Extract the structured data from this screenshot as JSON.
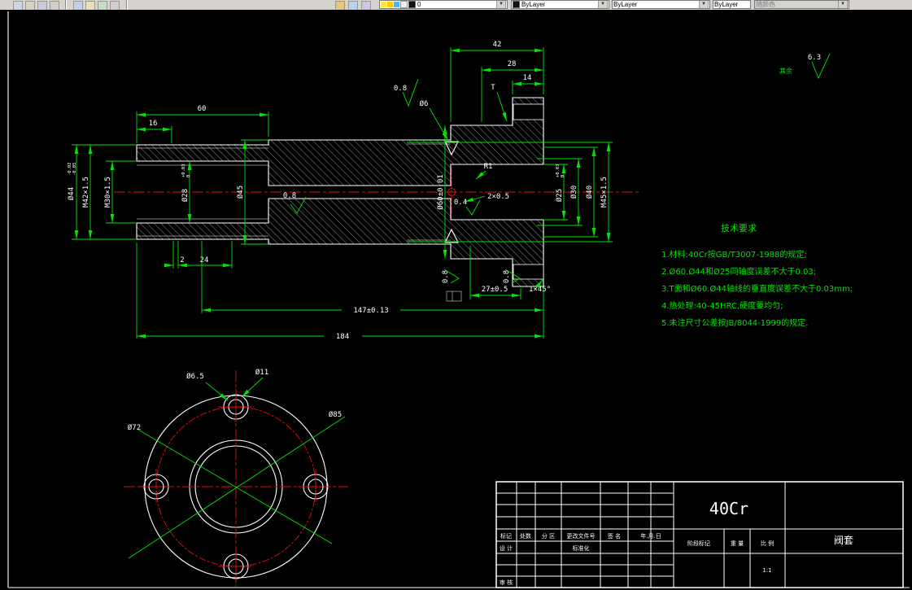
{
  "toolbar": {
    "layer_value": "0",
    "color_value": "ByLayer",
    "linetype_value": "ByLayer",
    "lineweight_value": "ByLayer",
    "plotstyle_value": "随颜色"
  },
  "section_view": {
    "dims": {
      "len184": "184",
      "len147": "147±0.13",
      "len60": "60",
      "len16": "16",
      "len42": "42",
      "len28": "28",
      "len14": "14",
      "len2": "2",
      "len24": "24",
      "len27": "27±0.5",
      "chamfer": "1×45°",
      "t_face": "T",
      "hole6": "Ø6",
      "radius1": "R1",
      "groove": "2×0.5",
      "dia44": "Ø44",
      "dia44_hi": "-0.02",
      "dia44_lo": "-0.05",
      "m42": "M42×1.5",
      "m30": "M30×1.5",
      "dia28": "Ø28",
      "dia28_hi": "+0.03",
      "dia28_lo": "0",
      "dia45": "Ø45",
      "dia60": "Ø60±0.01",
      "dia25": "Ø25",
      "dia25_hi": "+0.03",
      "dia25_lo": "0",
      "dia30": "Ø30",
      "dia40": "Ø40",
      "m45": "M45×1.5",
      "ra_top": "0.8",
      "ra_bore": "0.8",
      "ra_mid": "0.4",
      "ra_left": "0.8",
      "ra_right": "0.8"
    }
  },
  "front_view": {
    "dia65": "Ø6.5",
    "dia11": "Ø11",
    "dia85": "Ø85",
    "dia72": "Ø72"
  },
  "surface_note": {
    "value": "6.3",
    "rest": "其余"
  },
  "tech_req": {
    "title": "技术要求",
    "lines": [
      "1.材料:40Cr按GB/T3007-1988的规定;",
      "2.Ø60.Ø44和Ø25同轴度误差不大于0.03;",
      "3.T面和Ø60.Ø44轴线的垂直度误差不大于0.03mm;",
      "4.热处理:40-45HRC,硬度要均匀;",
      "5.未注尺寸公差按JB/8044-1999的规定."
    ]
  },
  "title_block": {
    "material": "40Cr",
    "part_name": "阀套",
    "scale_value": "1:1",
    "labels": {
      "mark": "标记",
      "count": "处数",
      "zone": "分 区",
      "change_doc": "更改文件号",
      "sign": "签 名",
      "date": "年.月.日",
      "design": "设 计",
      "standard": "标准化",
      "audit": "审 核",
      "stage": "阶段标记",
      "weight": "重 量",
      "scale": "比 例"
    }
  }
}
